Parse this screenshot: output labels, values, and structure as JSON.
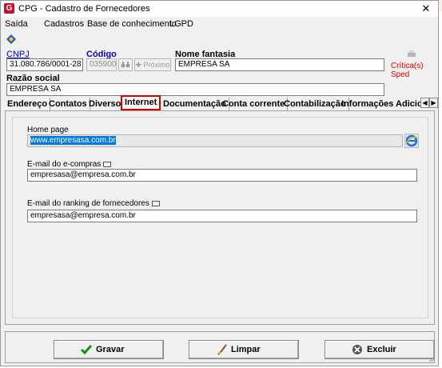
{
  "window": {
    "title": "CPG - Cadastro de Fornecedores",
    "app_icon": "G",
    "close": "✕"
  },
  "menu": [
    "Saída",
    "Cadastros",
    "Base de conhecimento",
    "LGPD"
  ],
  "header": {
    "cnpj_label": "CNPJ",
    "cnpj_value": "31.080.786/0001-28",
    "codigo_label": "Código",
    "codigo_value": "035900",
    "proximo_label": "Próximo",
    "nome_fantasia_label": "Nome fantasia",
    "nome_fantasia_value": "EMPRESA SA",
    "critica_label": "Crítica(s) Sped",
    "razao_social_label": "Razão social",
    "razao_social_value": "EMPRESA SA"
  },
  "tabs": [
    "Endereço",
    "Contatos",
    "Diversos",
    "Internet",
    "Documentação",
    "Conta corrente",
    "Contabilização",
    "Informações Adiciona"
  ],
  "active_tab": "Internet",
  "internet": {
    "home_page_label": "Home page",
    "home_page_value": "www.empresasa.com.br",
    "email_compras_label": "E-mail do e-compras",
    "email_compras_value": "empresasa@empresa.com.br",
    "email_ranking_label": "E-mail do ranking de fornecedores",
    "email_ranking_value": "empresasa@empresa.com.br"
  },
  "buttons": {
    "gravar": "Gravar",
    "limpar": "Limpar",
    "excluir": "Excluir"
  },
  "colors": {
    "accent": "#0078d7",
    "error": "#e00000",
    "highlight_border": "#d00000"
  }
}
